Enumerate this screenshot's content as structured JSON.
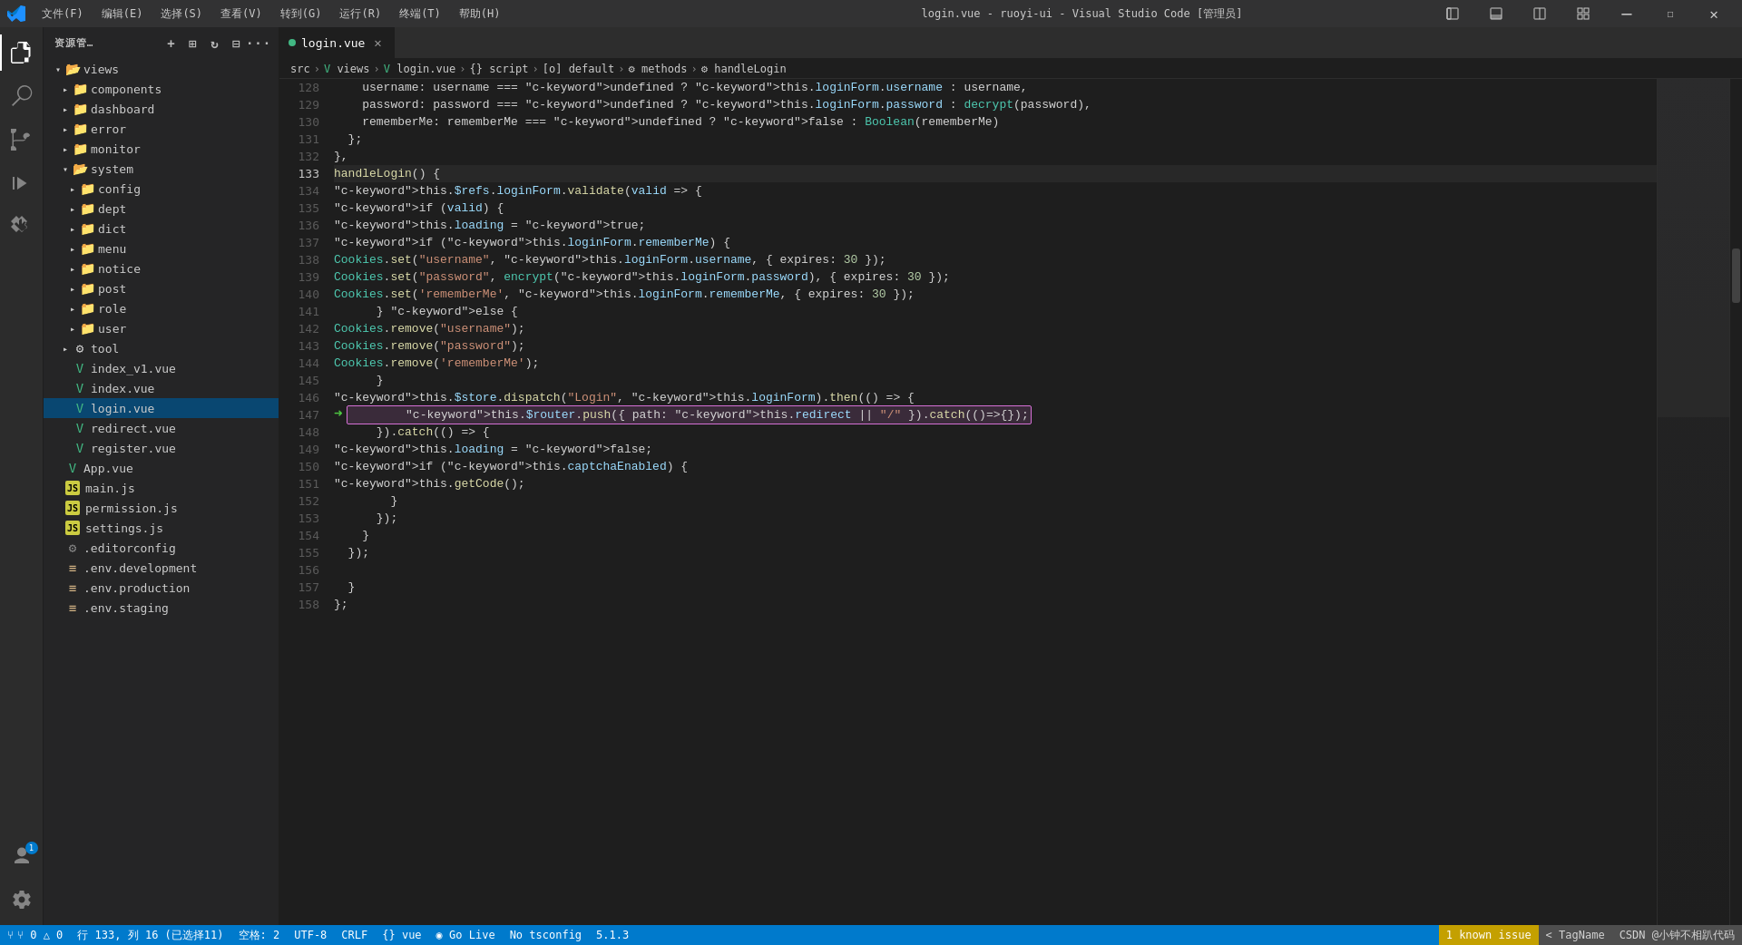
{
  "titleBar": {
    "menuItems": [
      "文件(F)",
      "编辑(E)",
      "选择(S)",
      "查看(V)",
      "转到(G)",
      "运行(R)",
      "终端(T)",
      "帮助(H)"
    ],
    "title": "login.vue - ruoyi-ui - Visual Studio Code [管理员]"
  },
  "activityBar": {
    "items": [
      {
        "name": "explorer-icon",
        "icon": "⊞",
        "active": true
      },
      {
        "name": "search-icon",
        "icon": "🔍",
        "active": false
      },
      {
        "name": "source-control-icon",
        "icon": "⑂",
        "active": false
      },
      {
        "name": "run-icon",
        "icon": "▷",
        "active": false
      },
      {
        "name": "extensions-icon",
        "icon": "⧉",
        "active": false
      }
    ],
    "bottomItems": [
      {
        "name": "account-icon",
        "icon": "👤",
        "badge": "1"
      },
      {
        "name": "settings-icon",
        "icon": "⚙",
        "active": false
      }
    ]
  },
  "sidebar": {
    "title": "资源管…",
    "tree": [
      {
        "indent": 0,
        "type": "folder",
        "label": "views",
        "open": true,
        "arrow": "▾"
      },
      {
        "indent": 1,
        "type": "folder",
        "label": "components",
        "open": false,
        "arrow": "▸"
      },
      {
        "indent": 1,
        "type": "folder",
        "label": "dashboard",
        "open": false,
        "arrow": "▸"
      },
      {
        "indent": 1,
        "type": "folder",
        "label": "error",
        "open": false,
        "arrow": "▸"
      },
      {
        "indent": 1,
        "type": "folder",
        "label": "monitor",
        "open": false,
        "arrow": "▸"
      },
      {
        "indent": 1,
        "type": "folder",
        "label": "system",
        "open": true,
        "arrow": "▾"
      },
      {
        "indent": 2,
        "type": "folder",
        "label": "config",
        "open": false,
        "arrow": "▸"
      },
      {
        "indent": 2,
        "type": "folder",
        "label": "dept",
        "open": false,
        "arrow": "▸"
      },
      {
        "indent": 2,
        "type": "folder",
        "label": "dict",
        "open": false,
        "arrow": "▸"
      },
      {
        "indent": 2,
        "type": "folder",
        "label": "menu",
        "open": false,
        "arrow": "▸"
      },
      {
        "indent": 2,
        "type": "folder",
        "label": "notice",
        "open": false,
        "arrow": "▸"
      },
      {
        "indent": 2,
        "type": "folder",
        "label": "post",
        "open": false,
        "arrow": "▸"
      },
      {
        "indent": 2,
        "type": "folder",
        "label": "role",
        "open": false,
        "arrow": "▸"
      },
      {
        "indent": 2,
        "type": "folder",
        "label": "user",
        "open": false,
        "arrow": "▸"
      },
      {
        "indent": 1,
        "type": "folder",
        "label": "tool",
        "open": false,
        "arrow": "▸",
        "special": true
      },
      {
        "indent": 1,
        "type": "vue",
        "label": "index_v1.vue"
      },
      {
        "indent": 1,
        "type": "vue",
        "label": "index.vue"
      },
      {
        "indent": 1,
        "type": "vue",
        "label": "login.vue",
        "selected": true
      },
      {
        "indent": 1,
        "type": "vue",
        "label": "redirect.vue"
      },
      {
        "indent": 1,
        "type": "vue",
        "label": "register.vue"
      },
      {
        "indent": 0,
        "type": "vue",
        "label": "App.vue"
      },
      {
        "indent": 0,
        "type": "js",
        "label": "main.js"
      },
      {
        "indent": 0,
        "type": "js",
        "label": "permission.js"
      },
      {
        "indent": 0,
        "type": "js",
        "label": "settings.js"
      },
      {
        "indent": 0,
        "type": "config",
        "label": ".editorconfig"
      },
      {
        "indent": 0,
        "type": "env",
        "label": ".env.development"
      },
      {
        "indent": 0,
        "type": "env",
        "label": ".env.production"
      },
      {
        "indent": 0,
        "type": "env",
        "label": ".env.staging"
      }
    ]
  },
  "tabs": [
    {
      "label": "login.vue",
      "type": "vue",
      "active": true
    }
  ],
  "breadcrumb": {
    "items": [
      "src",
      "views",
      "login.vue",
      "{} script",
      "[o] default",
      "methods",
      "handleLogin"
    ]
  },
  "editor": {
    "filename": "login.vue",
    "lines": [
      {
        "num": 128,
        "content": "    username: username === undefined ? this.loginForm.username : username,"
      },
      {
        "num": 129,
        "content": "    password: password === undefined ? this.loginForm.password : decrypt(password),"
      },
      {
        "num": 130,
        "content": "    rememberMe: rememberMe === undefined ? false : Boolean(rememberMe)"
      },
      {
        "num": 131,
        "content": "  };"
      },
      {
        "num": 132,
        "content": "},"
      },
      {
        "num": 133,
        "content": "handleLogin() {",
        "active": true,
        "lightbulb": true
      },
      {
        "num": 134,
        "content": "  this.$refs.loginForm.validate(valid => {"
      },
      {
        "num": 135,
        "content": "    if (valid) {"
      },
      {
        "num": 136,
        "content": "      this.loading = true;"
      },
      {
        "num": 137,
        "content": "      if (this.loginForm.rememberMe) {"
      },
      {
        "num": 138,
        "content": "        Cookies.set(\"username\", this.loginForm.username, { expires: 30 });"
      },
      {
        "num": 139,
        "content": "        Cookies.set(\"password\", encrypt(this.loginForm.password), { expires: 30 });"
      },
      {
        "num": 140,
        "content": "        Cookies.set('rememberMe', this.loginForm.rememberMe, { expires: 30 });"
      },
      {
        "num": 141,
        "content": "      } else {"
      },
      {
        "num": 142,
        "content": "        Cookies.remove(\"username\");"
      },
      {
        "num": 143,
        "content": "        Cookies.remove(\"password\");"
      },
      {
        "num": 144,
        "content": "        Cookies.remove('rememberMe');"
      },
      {
        "num": 145,
        "content": "      }"
      },
      {
        "num": 146,
        "content": "      this.$store.dispatch(\"Login\", this.loginForm).then(() => {"
      },
      {
        "num": 147,
        "content": "        this.$router.push({ path: this.redirect || \"/\" }).catch(()=>{});",
        "highlighted": true,
        "arrow": true
      },
      {
        "num": 148,
        "content": "      }).catch(() => {"
      },
      {
        "num": 149,
        "content": "        this.loading = false;"
      },
      {
        "num": 150,
        "content": "        if (this.captchaEnabled) {"
      },
      {
        "num": 151,
        "content": "          this.getCode();"
      },
      {
        "num": 152,
        "content": "        }"
      },
      {
        "num": 153,
        "content": "      });"
      },
      {
        "num": 154,
        "content": "    }"
      },
      {
        "num": 155,
        "content": "  });"
      },
      {
        "num": 156,
        "content": ""
      },
      {
        "num": 157,
        "content": "  }"
      },
      {
        "num": 158,
        "content": "};"
      }
    ]
  },
  "statusBar": {
    "left": [
      {
        "label": "⑂ 0 △ 0"
      },
      {
        "label": "行 133, 列 16 (已选择11)"
      },
      {
        "label": "空格: 2"
      },
      {
        "label": "UTF-8"
      },
      {
        "label": "CRLF"
      },
      {
        "label": "{} vue"
      },
      {
        "label": "◉ Go Live"
      },
      {
        "label": "No tsconfig"
      },
      {
        "label": "5.1.3"
      }
    ],
    "knownIssue": "1 known issue",
    "tagName": "< TagName",
    "watermark": "CSDN @小钟不相趴代码"
  }
}
